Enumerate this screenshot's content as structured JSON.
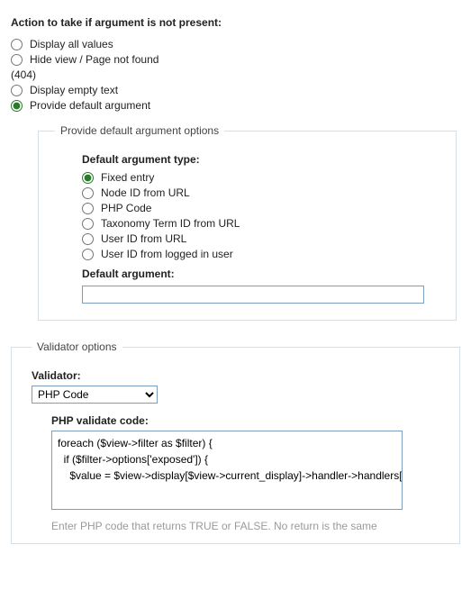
{
  "action": {
    "heading": "Action to take if argument is not present:",
    "options": [
      {
        "label": "Display all values"
      },
      {
        "label": "Hide view / Page not found"
      },
      {
        "suffix_404": "(404)"
      },
      {
        "label": "Display empty text"
      },
      {
        "label": "Provide default argument"
      }
    ]
  },
  "default_arg_box": {
    "legend": "Provide default argument options",
    "type_heading": "Default argument type:",
    "types": [
      "Fixed entry",
      "Node ID from URL",
      "PHP Code",
      "Taxonomy Term ID from URL",
      "User ID from URL",
      "User ID from logged in user"
    ],
    "default_argument_label": "Default argument:",
    "default_argument_value": ""
  },
  "validator_box": {
    "legend": "Validator options",
    "validator_label": "Validator:",
    "validator_selected": "PHP Code",
    "code_label": "PHP validate code:",
    "code_value": "foreach ($view->filter as $filter) {\n  if ($filter->options['exposed']) {\n    $value = $view->display[$view->current_display]->handler->handlers['filter'][$filter->options['id']]->value;",
    "help_text": "Enter PHP code that returns TRUE or FALSE. No return is the same"
  }
}
